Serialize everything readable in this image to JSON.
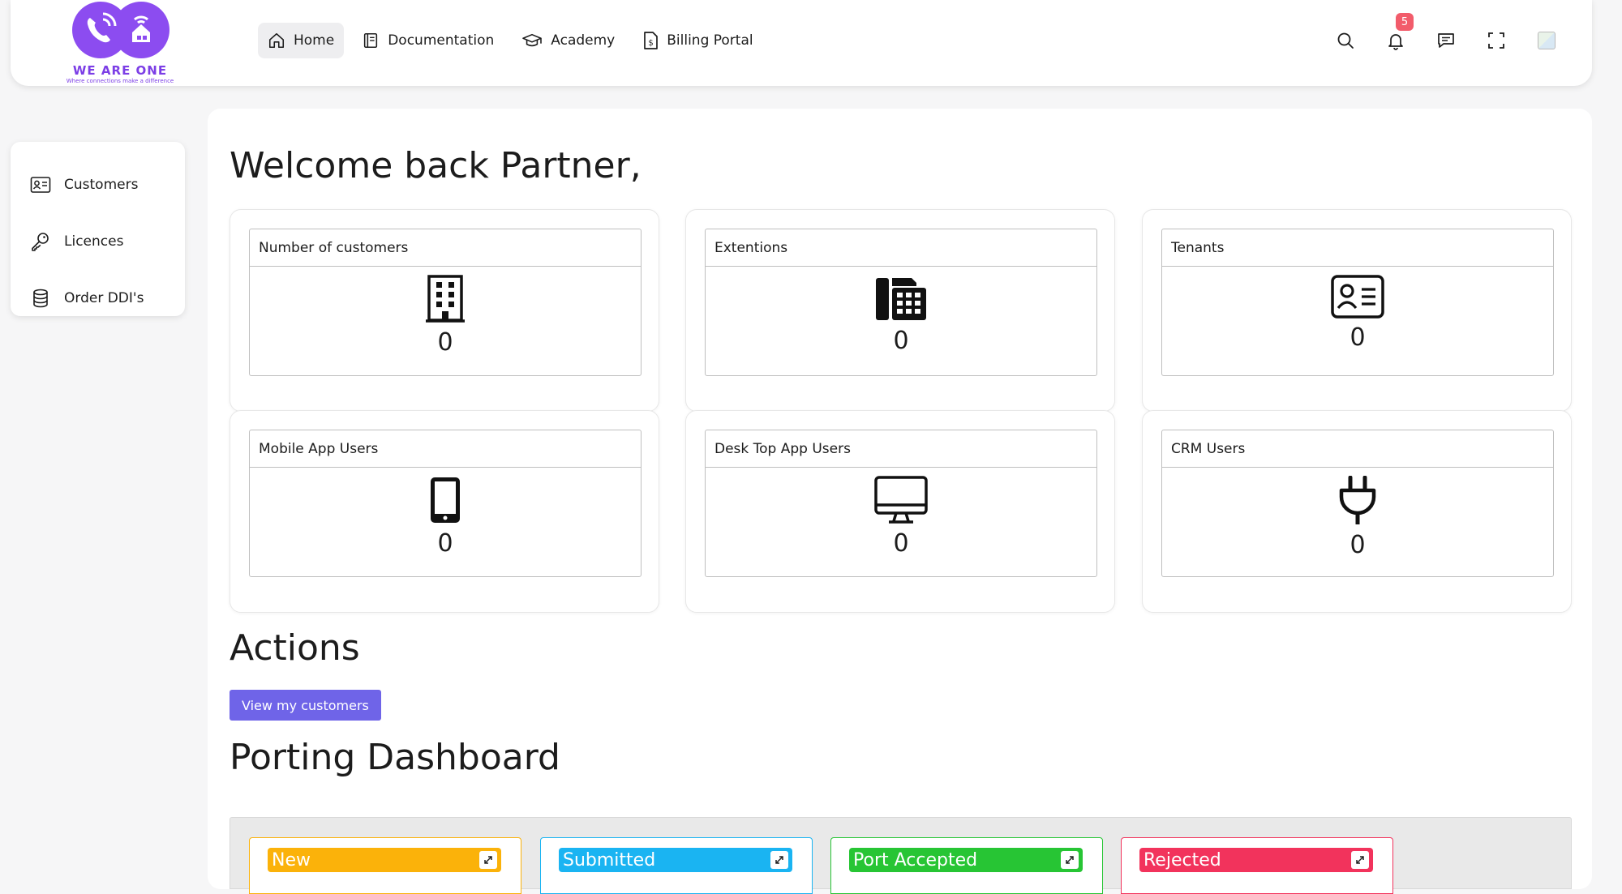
{
  "brand": {
    "name": "WE ARE ONE",
    "tagline": "Where connections make a difference",
    "accent": "#7c3ee6"
  },
  "nav": {
    "items": [
      {
        "label": "Home",
        "icon": "home-icon",
        "active": true
      },
      {
        "label": "Documentation",
        "icon": "book-icon",
        "active": false
      },
      {
        "label": "Academy",
        "icon": "graduation-cap-icon",
        "active": false
      },
      {
        "label": "Billing Portal",
        "icon": "invoice-icon",
        "active": false
      }
    ],
    "notifications_count": "5",
    "right_icons": [
      "search-icon",
      "bell-icon",
      "chat-icon",
      "fullscreen-icon",
      "avatar"
    ]
  },
  "sidebar": {
    "items": [
      {
        "label": "Customers",
        "icon": "id-card-icon"
      },
      {
        "label": "Licences",
        "icon": "key-icon"
      },
      {
        "label": "Order DDI's",
        "icon": "database-icon"
      }
    ]
  },
  "main": {
    "welcome": "Welcome back Partner,",
    "stats": [
      {
        "title": "Number of customers",
        "value": "0",
        "icon": "building-icon"
      },
      {
        "title": "Extentions",
        "value": "0",
        "icon": "fax-icon"
      },
      {
        "title": "Tenants",
        "value": "0",
        "icon": "id-card-icon"
      },
      {
        "title": "Mobile App Users",
        "value": "0",
        "icon": "phone-icon"
      },
      {
        "title": "Desk Top App Users",
        "value": "0",
        "icon": "desktop-icon"
      },
      {
        "title": "CRM Users",
        "value": "0",
        "icon": "plug-icon"
      }
    ],
    "actions_title": "Actions",
    "view_customers_label": "View my customers",
    "porting_title": "Porting Dashboard",
    "porting_columns": [
      {
        "label": "New",
        "color": "#fbb20a"
      },
      {
        "label": "Submitted",
        "color": "#1ab4f2"
      },
      {
        "label": "Port Accepted",
        "color": "#27c534"
      },
      {
        "label": "Rejected",
        "color": "#f2335c"
      }
    ]
  }
}
